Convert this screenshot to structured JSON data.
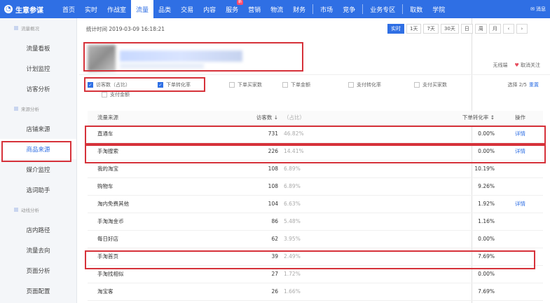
{
  "app": {
    "title": "生意参谋"
  },
  "nav": {
    "items": [
      {
        "label": "首页"
      },
      {
        "label": "实时"
      },
      {
        "label": "作战室"
      },
      {
        "label": "流量",
        "active": true
      },
      {
        "label": "品类"
      },
      {
        "label": "交易"
      },
      {
        "label": "内容"
      },
      {
        "label": "服务",
        "badge": "新"
      },
      {
        "label": "营销"
      },
      {
        "label": "物流"
      },
      {
        "label": "财务"
      }
    ],
    "items2": [
      {
        "label": "市场"
      },
      {
        "label": "竞争"
      }
    ],
    "items3": [
      {
        "label": "业务专区"
      }
    ],
    "items4": [
      {
        "label": "取数"
      },
      {
        "label": "学院"
      }
    ],
    "message": "消息"
  },
  "sidebar": {
    "sections": [
      {
        "title": "流量概况",
        "items": [
          {
            "label": "流量看板"
          },
          {
            "label": "计划监控"
          },
          {
            "label": "访客分析"
          }
        ]
      },
      {
        "title": "来源分析",
        "items": [
          {
            "label": "店铺来源"
          },
          {
            "label": "商品来源",
            "active": true
          },
          {
            "label": "媒介监控"
          },
          {
            "label": "选词助手"
          }
        ]
      },
      {
        "title": "动线分析",
        "items": [
          {
            "label": "店内路径"
          },
          {
            "label": "流量去向"
          },
          {
            "label": "页面分析"
          },
          {
            "label": "页面配置"
          }
        ]
      }
    ]
  },
  "header": {
    "stat_time": "统计时间 2019-03-09 16:18:21",
    "ranges": [
      "实时",
      "1天",
      "7天",
      "30天",
      "日",
      "周",
      "月",
      "‹",
      "›"
    ],
    "follow_left": "无线端",
    "follow_right": "取消关注"
  },
  "filters": {
    "items": [
      {
        "label": "访客数（占比）",
        "checked": true
      },
      {
        "label": "下单转化率",
        "checked": true
      },
      {
        "label": "下单买家数",
        "checked": false
      },
      {
        "label": "下单金额",
        "checked": false
      },
      {
        "label": "支付转化率",
        "checked": false
      },
      {
        "label": "支付买家数",
        "checked": false
      },
      {
        "label": "支付金额",
        "checked": false
      }
    ],
    "select_text": "选择 2/5",
    "reset": "重置"
  },
  "table": {
    "headers": {
      "source": "流量来源",
      "visitors": "访客数 ↓",
      "pct": "（占比）",
      "conv": "下单转化率 ↕",
      "action": "操作"
    },
    "rows": [
      {
        "source": "直通车",
        "visitors": "731",
        "pct": "46.82%",
        "conv": "0.00%",
        "action": "详情"
      },
      {
        "source": "手淘搜索",
        "visitors": "226",
        "pct": "14.41%",
        "conv": "0.00%",
        "action": "详情"
      },
      {
        "source": "我的淘宝",
        "visitors": "108",
        "pct": "6.89%",
        "conv": "10.19%",
        "action": ""
      },
      {
        "source": "购物车",
        "visitors": "108",
        "pct": "6.89%",
        "conv": "9.26%",
        "action": ""
      },
      {
        "source": "淘内免费其他",
        "visitors": "104",
        "pct": "6.63%",
        "conv": "1.92%",
        "action": "详情"
      },
      {
        "source": "手淘淘金币",
        "visitors": "86",
        "pct": "5.48%",
        "conv": "1.16%",
        "action": ""
      },
      {
        "source": "每日好店",
        "visitors": "62",
        "pct": "3.95%",
        "conv": "0.00%",
        "action": ""
      },
      {
        "source": "手淘首页",
        "visitors": "39",
        "pct": "2.49%",
        "conv": "7.69%",
        "action": ""
      },
      {
        "source": "手淘找相似",
        "visitors": "27",
        "pct": "1.72%",
        "conv": "0.00%",
        "action": ""
      },
      {
        "source": "淘宝客",
        "visitors": "26",
        "pct": "1.66%",
        "conv": "7.69%",
        "action": ""
      }
    ]
  }
}
